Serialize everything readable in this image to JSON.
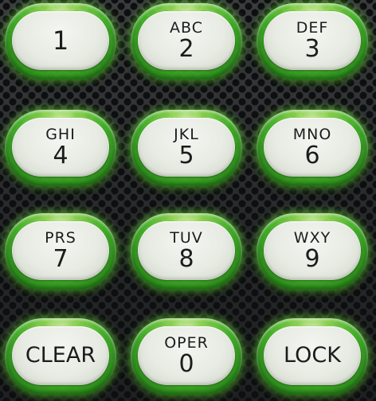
{
  "keys": [
    {
      "letters": "",
      "digit": "1"
    },
    {
      "letters": "ABC",
      "digit": "2"
    },
    {
      "letters": "DEF",
      "digit": "3"
    },
    {
      "letters": "GHI",
      "digit": "4"
    },
    {
      "letters": "JKL",
      "digit": "5"
    },
    {
      "letters": "MNO",
      "digit": "6"
    },
    {
      "letters": "PRS",
      "digit": "7"
    },
    {
      "letters": "TUV",
      "digit": "8"
    },
    {
      "letters": "WXY",
      "digit": "9"
    },
    {
      "letters": "CLEAR",
      "digit": ""
    },
    {
      "letters": "OPER",
      "digit": "0"
    },
    {
      "letters": "LOCK",
      "digit": ""
    }
  ],
  "colors": {
    "glow": "#6fe63c",
    "keycap": "#e9ede6",
    "panel": "#2b2d2f",
    "text": "#1c1c1c"
  }
}
